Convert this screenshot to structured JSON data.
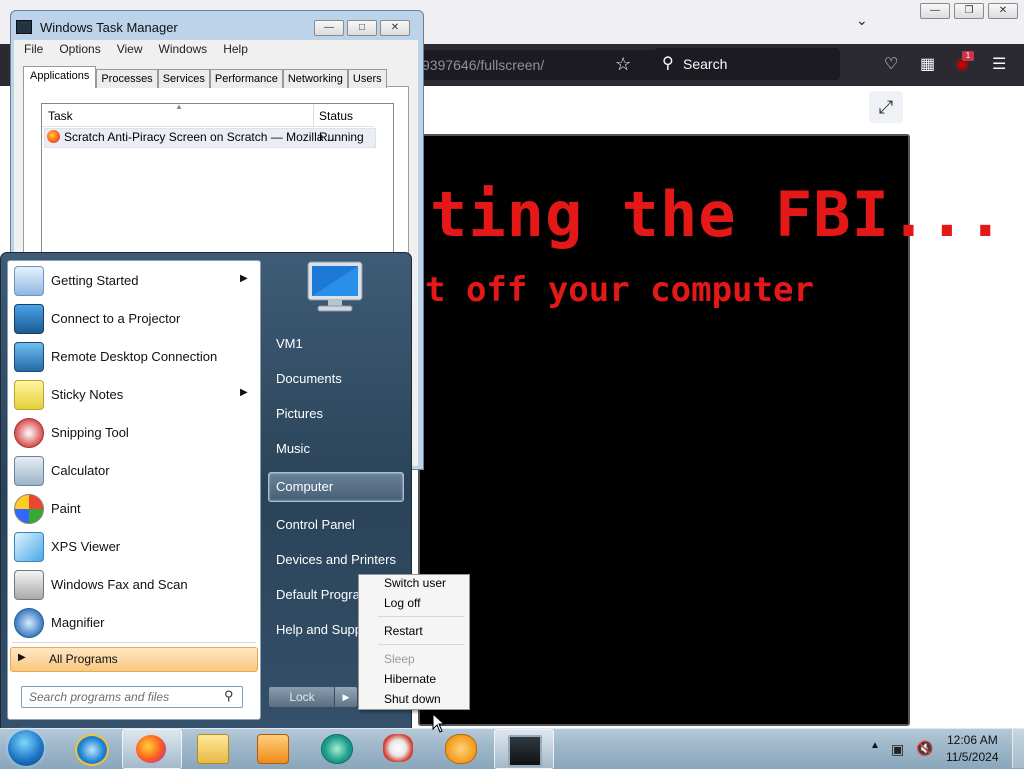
{
  "firefox": {
    "url": "9397646/fullscreen/",
    "search_placeholder": "Search",
    "badge": "1",
    "stage_line1": "ting the FBI...",
    "stage_line2": "t off your computer",
    "icons": {
      "star": "star-icon",
      "search": "search-icon",
      "pocket": "pocket-icon",
      "extensions": "extensions-icon",
      "ublock": "ublock-icon",
      "menu": "hamburger-menu-icon",
      "exit_fullscreen": "exit-fullscreen-icon"
    }
  },
  "task_manager": {
    "title": "Windows Task Manager",
    "menu": [
      "File",
      "Options",
      "View",
      "Windows",
      "Help"
    ],
    "tabs": [
      "Applications",
      "Processes",
      "Services",
      "Performance",
      "Networking",
      "Users"
    ],
    "columns": {
      "task": "Task",
      "status": "Status"
    },
    "rows": [
      {
        "task": "Scratch Anti-Piracy Screen on Scratch — Mozilla ...",
        "status": "Running"
      }
    ]
  },
  "start_menu": {
    "programs": [
      {
        "label": "Getting Started",
        "has_submenu": true,
        "icon": "getting-started-icon"
      },
      {
        "label": "Connect to a Projector",
        "has_submenu": false,
        "icon": "projector-icon"
      },
      {
        "label": "Remote Desktop Connection",
        "has_submenu": false,
        "icon": "remote-desktop-icon"
      },
      {
        "label": "Sticky Notes",
        "has_submenu": true,
        "icon": "sticky-notes-icon"
      },
      {
        "label": "Snipping Tool",
        "has_submenu": false,
        "icon": "snipping-tool-icon"
      },
      {
        "label": "Calculator",
        "has_submenu": false,
        "icon": "calculator-icon"
      },
      {
        "label": "Paint",
        "has_submenu": false,
        "icon": "paint-icon"
      },
      {
        "label": "XPS Viewer",
        "has_submenu": false,
        "icon": "xps-viewer-icon"
      },
      {
        "label": "Windows Fax and Scan",
        "has_submenu": false,
        "icon": "fax-scan-icon"
      },
      {
        "label": "Magnifier",
        "has_submenu": false,
        "icon": "magnifier-icon"
      }
    ],
    "all_programs": "All Programs",
    "search_placeholder": "Search programs and files",
    "right_items": [
      "VM1",
      "Documents",
      "Pictures",
      "Music",
      "Computer",
      "Control Panel",
      "Devices and Printers",
      "Default Programs",
      "Help and Support"
    ],
    "lock_label": "Lock"
  },
  "power_menu": {
    "items": [
      {
        "label": "Switch user",
        "enabled": true
      },
      {
        "label": "Log off",
        "enabled": true
      },
      {
        "label": "Restart",
        "enabled": true
      },
      {
        "label": "Sleep",
        "enabled": false
      },
      {
        "label": "Hibernate",
        "enabled": true
      },
      {
        "label": "Shut down",
        "enabled": true
      }
    ]
  },
  "taskbar": {
    "apps": [
      "start-orb-icon",
      "internet-explorer-icon",
      "firefox-icon",
      "file-explorer-icon",
      "media-player-icon",
      "app-icon",
      "scratch-icon",
      "scratch-cat-icon",
      "task-manager-icon"
    ],
    "clock_time": "12:06 AM",
    "clock_date": "11/5/2024"
  }
}
